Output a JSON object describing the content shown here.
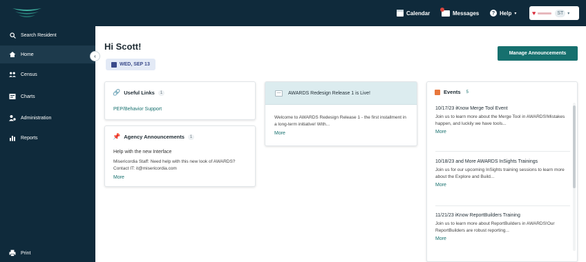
{
  "header": {
    "calendar_label": "Calendar",
    "messages_label": "Messages",
    "help_label": "Help",
    "user_initials": "ST"
  },
  "sidebar": {
    "search_label": "Search Resident",
    "items": [
      {
        "label": "Home",
        "icon": "home-icon"
      },
      {
        "label": "Census",
        "icon": "census-icon"
      },
      {
        "label": "Charts",
        "icon": "charts-icon"
      },
      {
        "label": "Administration",
        "icon": "administration-icon"
      },
      {
        "label": "Reports",
        "icon": "reports-icon"
      }
    ],
    "print_label": "Print"
  },
  "main": {
    "greeting": "Hi Scott!",
    "date": "WED, SEP 13",
    "manage_button": "Manage Announcements"
  },
  "useful_links": {
    "title": "Useful Links",
    "count": "1",
    "link": "PEP/Behavior Support"
  },
  "agency_announcements": {
    "title": "Agency Announcements",
    "count": "1",
    "heading": "Help with the new Interface",
    "body": "Misericordia Staff: Need help with this new look of AWARDS? Contact IT: it@misericordia.com",
    "more": "More"
  },
  "release": {
    "title": "AWARDS Redesign Release 1 is Live!",
    "body": "Welcome to AWARDS Redesign Release 1 - the first installment in a long-term initiative! With...",
    "more": "More"
  },
  "events": {
    "title": "Events",
    "count": "5",
    "items": [
      {
        "title": "10/17/23 iKnow Merge Tool Event",
        "body": "Join us to learn more about the Merge Tool in AWARDS!Mistakes happen, and luckily we have tools...",
        "more": "More"
      },
      {
        "title": "10/18/23 and More AWARDS InSights Trainings",
        "body": "Join us for our upcoming InSights training sessions to learn more about the Explore and Build...",
        "more": "More"
      },
      {
        "title": "11/21/23 iKnow ReportBuilders Training",
        "body": "Join us to learn more about ReportBuilders in AWARDS!Our ReportBuilders are robust reporting...",
        "more": "More"
      }
    ]
  },
  "colors": {
    "navy": "#0f2a3b",
    "teal": "#16706e",
    "accent_orange": "#e8773c"
  }
}
